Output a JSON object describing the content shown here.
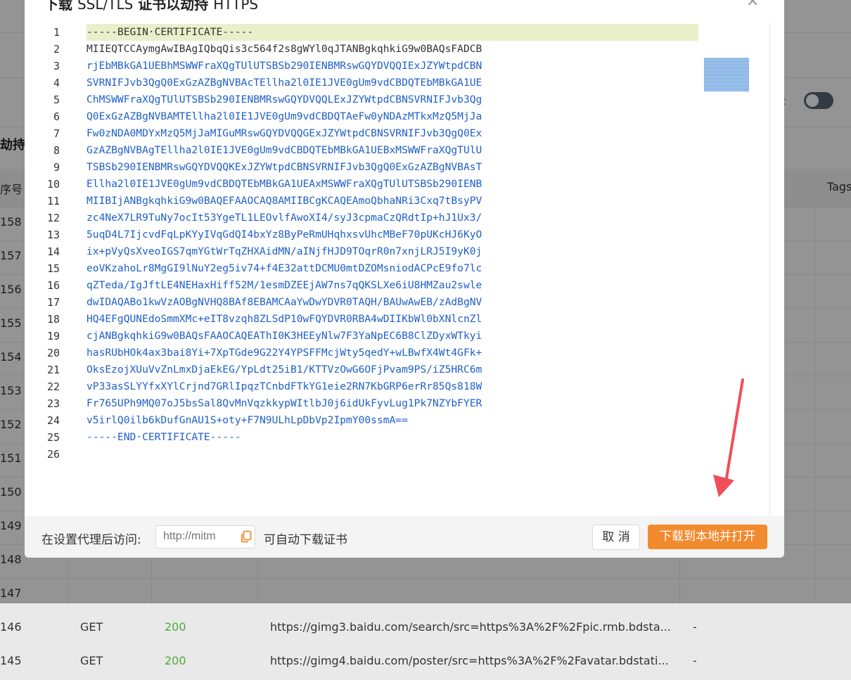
{
  "modal": {
    "title_cn1": "下载",
    "title_latin": "SSL/TLS",
    "title_cn2": "证书以劫持",
    "title_latin2": "HTTPS",
    "close_icon": "close-icon"
  },
  "editor": {
    "lines": [
      {
        "n": "1",
        "text": "-----BEGIN·CERTIFICATE-----"
      },
      {
        "n": "2",
        "text": "MIIEQTCCAymgAwIBAgIQbqQis3c564f2s8gWYl0qJTANBgkqhkiG9w0BAQsFADCB"
      },
      {
        "n": "3",
        "text": "rjEbMBkGA1UEBhMSWWFraXQgTUlUTSBSb290IENBMRswGQYDVQQIExJZYWtpdCBN"
      },
      {
        "n": "4",
        "text": "SVRNIFJvb3QgQ0ExGzAZBgNVBAcTEllha2l0IE1JVE0gUm9vdCBDQTEbMBkGA1UE"
      },
      {
        "n": "5",
        "text": "ChMSWWFraXQgTUlUTSBSb290IENBMRswGQYDVQQLExJZYWtpdCBNSVRNIFJvb3Qg"
      },
      {
        "n": "6",
        "text": "Q0ExGzAZBgNVBAMTEllha2l0IE1JVE0gUm9vdCBDQTAeFw0yNDAzMTkxMzQ5MjJa"
      },
      {
        "n": "7",
        "text": "Fw0zNDA0MDYxMzQ5MjJaMIGuMRswGQYDVQQGExJZYWtpdCBNSVRNIFJvb3QgQ0Ex"
      },
      {
        "n": "8",
        "text": "GzAZBgNVBAgTEllha2l0IE1JVE0gUm9vdCBDQTEbMBkGA1UEBxMSWWFraXQgTUlU"
      },
      {
        "n": "9",
        "text": "TSBSb290IENBMRswGQYDVQQKExJZYWtpdCBNSVRNIFJvb3QgQ0ExGzAZBgNVBAsT"
      },
      {
        "n": "10",
        "text": "Ellha2l0IE1JVE0gUm9vdCBDQTEbMBkGA1UEAxMSWWFraXQgTUlUTSBSb290IENB"
      },
      {
        "n": "11",
        "text": "MIIBIjANBgkqhkiG9w0BAQEFAAOCAQ8AMIIBCgKCAQEAmoQbhaNRi3Cxq7tBsyPV"
      },
      {
        "n": "12",
        "text": "zc4NeX7LR9TuNy7ocIt53YgeTL1LEOvlfAwoXI4/syJ3cpmaCzQRdtIp+hJ1Ux3/"
      },
      {
        "n": "13",
        "text": "5uqD4L7IjcvdFqLpKYyIVqGdQI4bxYz8ByPeRmUHqhxsvUhcMBeF70pUKcHJ6KyO"
      },
      {
        "n": "14",
        "text": "ix+pVyQsXveoIGS7qmYGtWrTqZHXAidMN/aINjfHJD9TOqrR0n7xnjLRJ5I9yK0j"
      },
      {
        "n": "15",
        "text": "eoVKzahoLr8MgGI9lNuY2eg5iv74+f4E32attDCMU0mtDZOMsniodACPcE9fo7lc"
      },
      {
        "n": "16",
        "text": "qZTeda/IgJftLE4NEHaxHiff52M/1esmDZEEjAW7ns7qQKSLXe6iU8HMZau2swle"
      },
      {
        "n": "17",
        "text": "dwIDAQABo1kwVzAOBgNVHQ8BAf8EBAMCAaYwDwYDVR0TAQH/BAUwAwEB/zAdBgNV"
      },
      {
        "n": "18",
        "text": "HQ4EFgQUNEdoSmmXMc+eIT8vzqh8ZLSdP10wFQYDVR0RBA4wDIIKbWl0bXNlcnZl"
      },
      {
        "n": "19",
        "text": "cjANBgkqhkiG9w0BAQsFAAOCAQEAThI0K3HEEyNlw7F3YaNpEC6B8ClZDyxWTkyi"
      },
      {
        "n": "20",
        "text": "hasRUbHOk4ax3bai8Yi+7XpTGde9G22Y4YPSFFMcjWty5qedY+wLBwfX4Wt4GFk+"
      },
      {
        "n": "21",
        "text": "OksEzojXUuVvZnLmxDjaEkEG/YpLdt25iB1/KTTVzOwG6OFjPvam9PS/iZ5HRC6m"
      },
      {
        "n": "22",
        "text": "vP33asSLYYfxXYlCrjnd7GRlIpqzTCnbdFTkYG1eie2RN7KbGRP6erRr85Qs818W"
      },
      {
        "n": "23",
        "text": "Fr765UPh9MQ07oJ5bsSal8QvMnVqzkkypWItlbJ0j6idUkFyvLug1Pk7NZYbFYER"
      },
      {
        "n": "24",
        "text": "v5irlQ0ilb6kDufGnAU1S+oty+F7N9ULhLpDbVp2IpmY00ssmA=="
      },
      {
        "n": "25",
        "text": "-----END·CERTIFICATE-----"
      },
      {
        "n": "26",
        "text": ""
      }
    ]
  },
  "footer": {
    "label": "在设置代理后访问:",
    "url_placeholder": "http://mitm",
    "after": "可自动下载证书",
    "cancel": "取 消",
    "primary": "下载到本地并打开"
  },
  "background": {
    "section_title": "劫持",
    "col_index": "序号",
    "col_tags": "Tags",
    "toggle_label": "t:",
    "rows": [
      {
        "n": "158"
      },
      {
        "n": "157"
      },
      {
        "n": "156"
      },
      {
        "n": "155"
      },
      {
        "n": "154"
      },
      {
        "n": "153"
      },
      {
        "n": "152"
      },
      {
        "n": "151"
      },
      {
        "n": "150"
      },
      {
        "n": "149"
      },
      {
        "n": "148"
      },
      {
        "n": "147"
      },
      {
        "n": "146",
        "method": "GET",
        "status": "200",
        "url": "https://gimg3.baidu.com/search/src=https%3A%2F%2Fpic.rmb.bdsta...",
        "tags": "-"
      },
      {
        "n": "145",
        "method": "GET",
        "status": "200",
        "url": "https://gimg4.baidu.com/poster/src=https%3A%2F%2Favatar.bdstati...",
        "tags": "-"
      }
    ]
  },
  "colors": {
    "primary": "#f28a2e",
    "code": "#2060c8",
    "active_line": "#e9efcb",
    "status_ok": "#52a838"
  }
}
